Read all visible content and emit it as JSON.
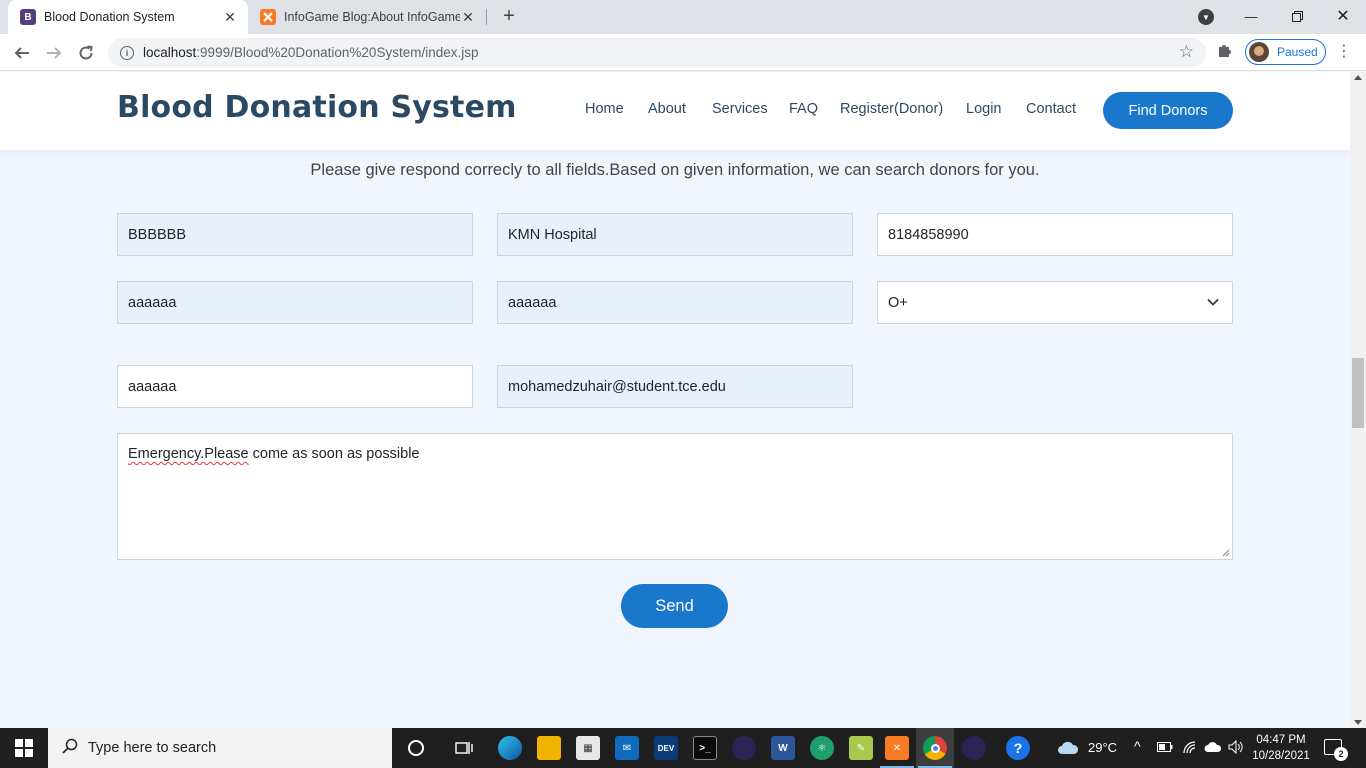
{
  "browser": {
    "tabs": [
      {
        "title": "Blood Donation System",
        "favicon": "B",
        "active": true
      },
      {
        "title": "InfoGame Blog:About InfoGame",
        "favicon": "xampp",
        "active": false
      }
    ],
    "url_host": "localhost",
    "url_rest": ":9999/Blood%20Donation%20System/index.jsp",
    "profile_status": "Paused"
  },
  "site": {
    "logo": "Blood Donation System",
    "nav": [
      "Home",
      "About",
      "Services",
      "FAQ",
      "Register(Donor)",
      "Login",
      "Contact"
    ],
    "cta": "Find Donors"
  },
  "form": {
    "intro": "Please give respond correcly to all fields.Based on given information, we can search donors for you.",
    "name": "BBBBBB",
    "hospital": "KMN Hospital",
    "phone": "8184858990",
    "field4": "aaaaaa",
    "field5": "aaaaaa",
    "blood_group": "O+",
    "field7": "aaaaaa",
    "email": "mohamedzuhair@student.tce.edu",
    "message_word1": "Emergency.Please",
    "message_rest": " come as soon as possible",
    "submit": "Send"
  },
  "taskbar": {
    "search_placeholder": "Type here to search",
    "weather": "29°C",
    "time": "04:47 PM",
    "date": "10/28/2021",
    "notifications": "2"
  },
  "colors": {
    "brand": "#2c4964",
    "accent": "#1977cc",
    "page_bg": "#f1f6fe",
    "autofill": "#e8f0fe"
  }
}
